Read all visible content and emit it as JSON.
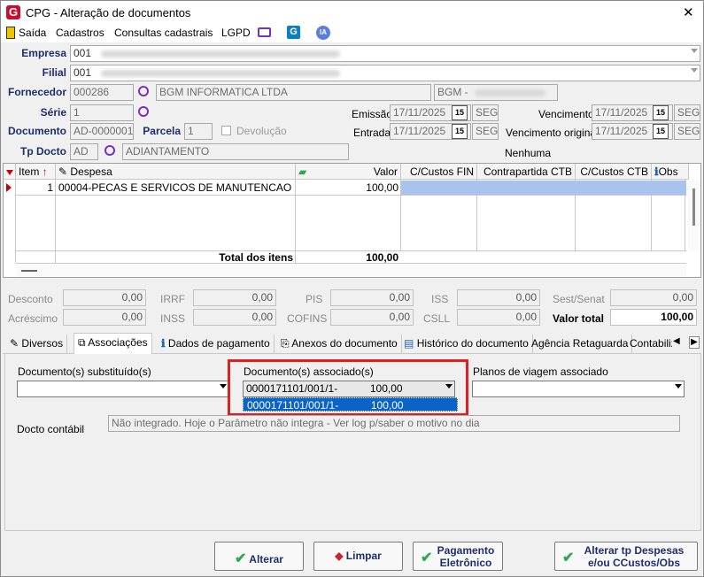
{
  "window": {
    "title": "CPG - Alteração de documentos",
    "close": "✕"
  },
  "menu": {
    "items": [
      "Saída",
      "Cadastros",
      "Consultas cadastrais",
      "LGPD"
    ],
    "ia": "IA"
  },
  "header": {
    "empresa_label": "Empresa",
    "empresa_value": "001",
    "filial_label": "Filial",
    "filial_value": "001",
    "fornecedor_label": "Fornecedor",
    "fornecedor_code": "000286",
    "fornecedor_name": "BGM INFORMATICA LTDA",
    "fornecedor_extra": "BGM -",
    "serie_label": "Série",
    "serie_value": "1",
    "documento_label": "Documento",
    "documento_value": "AD-0000001",
    "parcela_label": "Parcela",
    "parcela_value": "1",
    "devolucao_label": "Devolução",
    "tpdocto_label": "Tp Docto",
    "tpdocto_code": "AD",
    "tpdocto_name": "ADIANTAMENTO",
    "emissao_label": "Emissão",
    "emissao_value": "17/11/2025",
    "emissao_day": "SEG",
    "entrada_label": "Entrada",
    "entrada_value": "17/11/2025",
    "entrada_day": "SEG",
    "vencimento_label": "Vencimento",
    "vencimento_value": "17/11/2025",
    "vencimento_day": "SEG",
    "venc_orig_label": "Vencimento original",
    "venc_orig_value": "17/11/2025",
    "venc_orig_day": "SEG",
    "nenhuma": "Nenhuma",
    "cal_icon": "15"
  },
  "grid": {
    "columns": [
      "Item",
      "Despesa",
      "Valor",
      "C/Custos FIN",
      "Contrapartida CTB",
      "C/Custos CTB",
      "Obs"
    ],
    "rows": [
      {
        "item": "1",
        "despesa": "00004-PECAS E SERVICOS DE MANUTENCAO",
        "valor": "100,00"
      }
    ],
    "total_label": "Total dos itens",
    "total_value": "100,00"
  },
  "totals": {
    "desconto": {
      "label": "Desconto",
      "value": "0,00"
    },
    "acrescimo": {
      "label": "Acréscimo",
      "value": "0,00"
    },
    "irrf": {
      "label": "IRRF",
      "value": "0,00"
    },
    "inss": {
      "label": "INSS",
      "value": "0,00"
    },
    "pis": {
      "label": "PIS",
      "value": "0,00"
    },
    "cofins": {
      "label": "COFINS",
      "value": "0,00"
    },
    "iss": {
      "label": "ISS",
      "value": "0,00"
    },
    "csll": {
      "label": "CSLL",
      "value": "0,00"
    },
    "sest": {
      "label": "Sest/Senat",
      "value": "0,00"
    },
    "valor_total": {
      "label": "Valor total",
      "value": "100,00"
    }
  },
  "tabs": [
    "Diversos",
    "Associações",
    "Dados de pagamento",
    "Anexos do documento",
    "Histórico do documento",
    "Agência Retaguarda",
    "Contabiliz"
  ],
  "assoc": {
    "substituidos_label": "Documento(s) substituído(s)",
    "associados_label": "Documento(s) associado(s)",
    "associado_selected": "0000171101/001/1-           100,00",
    "associado_option": "0000171101/001/1-           100,00",
    "planos_label": "Planos de viagem associado",
    "docto_contabil_label": "Docto contábil",
    "docto_contabil_value": "Não integrado. Hoje o Parâmetro não integra - Ver log p/saber o motivo no dia"
  },
  "buttons": {
    "alterar": "Alterar",
    "limpar": "Limpar",
    "pagamento_line1": "Pagamento",
    "pagamento_line2": "Eletrônico",
    "alterar_tp_line1": "Alterar tp Despesas",
    "alterar_tp_line2": "e/ou CCustos/Obs"
  },
  "colors": {
    "highlight": "#e02020",
    "accent": "#1e2f6b",
    "selection": "#0a64c8"
  }
}
